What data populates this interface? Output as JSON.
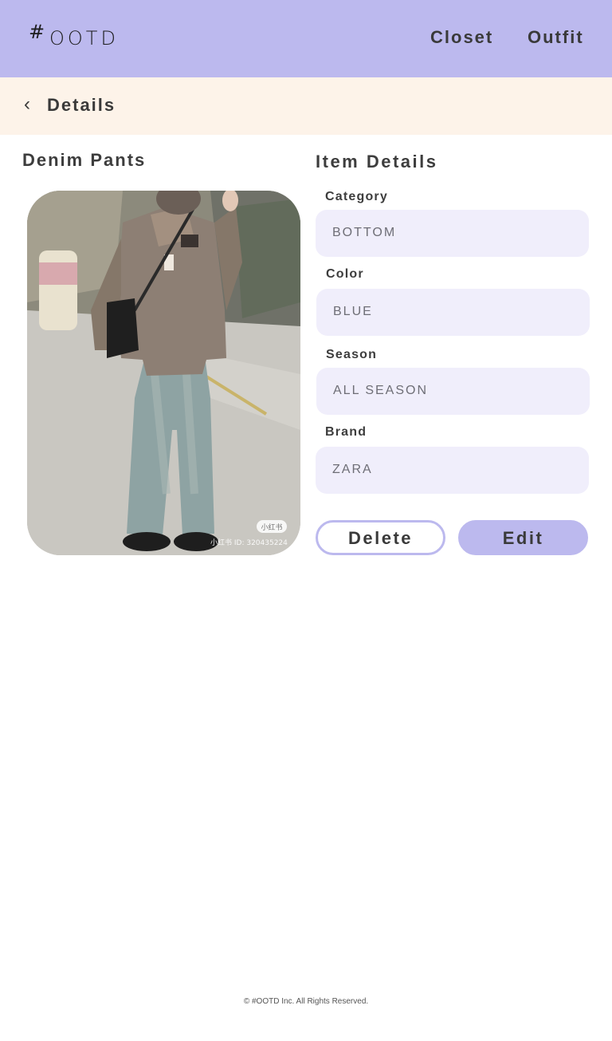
{
  "header": {
    "logo_hash": "#",
    "logo_word": "OOTD",
    "nav": [
      "Closet",
      "Outfit"
    ]
  },
  "subbar": {
    "back_icon": "chevron-left-icon",
    "back_glyph": "‹",
    "title": "Details"
  },
  "item": {
    "name": "Denim Pants",
    "photo_watermark": "小红书 ID: 320435224",
    "photo_badge": "小红书"
  },
  "details": {
    "title": "Item Details",
    "fields": [
      {
        "label": "Category",
        "value": "BOTTOM"
      },
      {
        "label": "Color",
        "value": "BLUE"
      },
      {
        "label": "Season",
        "value": "ALL SEASON"
      },
      {
        "label": "Brand",
        "value": "ZARA"
      }
    ]
  },
  "actions": {
    "delete_label": "Delete",
    "edit_label": "Edit"
  },
  "footer": {
    "text": "© #OOTD Inc. All Rights Reserved."
  },
  "colors": {
    "header_bg": "#bcb9ee",
    "subbar_bg": "#fdf3e9",
    "field_bg": "#f0eefb",
    "accent": "#bcb9ee"
  }
}
